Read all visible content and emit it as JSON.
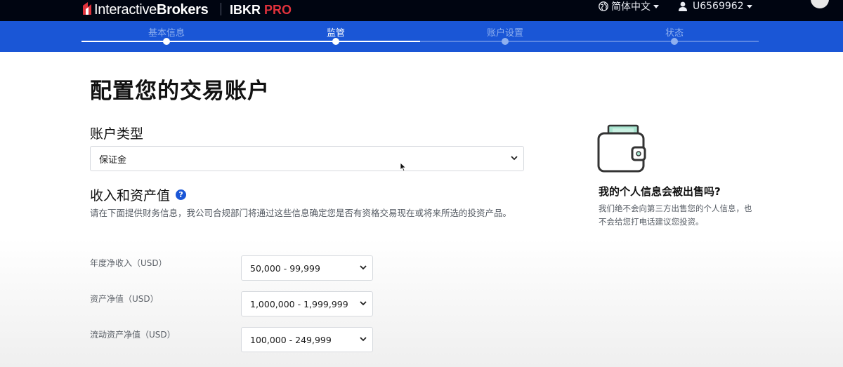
{
  "header": {
    "brand_regular": "Interactive",
    "brand_bold": "Brokers",
    "product": "IBKR",
    "product_accent": "PRO",
    "language": "简体中文",
    "username": "U6569962",
    "colors": {
      "background": "#000511",
      "accent_red": "#e0323c"
    }
  },
  "steps": [
    {
      "label": "基本信息",
      "state": "done"
    },
    {
      "label": "监管",
      "state": "current"
    },
    {
      "label": "账户设置",
      "state": "pending"
    },
    {
      "label": "状态",
      "state": "pending"
    }
  ],
  "stepbar_color": "#1a56d6",
  "main": {
    "title": "配置您的交易账户",
    "account_type": {
      "heading": "账户类型",
      "selected": "保证金"
    },
    "income": {
      "heading": "收入和资产值",
      "help_icon": "question-circle-icon",
      "description": "请在下面提供财务信息，我公司合规部门将通过这些信息确定您是否有资格交易现在或将来所选的投资产品。",
      "fields": [
        {
          "label": "年度净收入（USD）",
          "value": "50,000 - 99,999"
        },
        {
          "label": "资产净值（USD）",
          "value": "1,000,000 - 1,999,999"
        },
        {
          "label": "流动资产净值（USD）",
          "value": "100,000 - 249,999"
        }
      ]
    }
  },
  "side": {
    "icon": "wallet-icon",
    "title": "我的个人信息会被出售吗?",
    "text": "我们绝不会向第三方出售您的个人信息，也不会给您打电话建议您投资。"
  }
}
